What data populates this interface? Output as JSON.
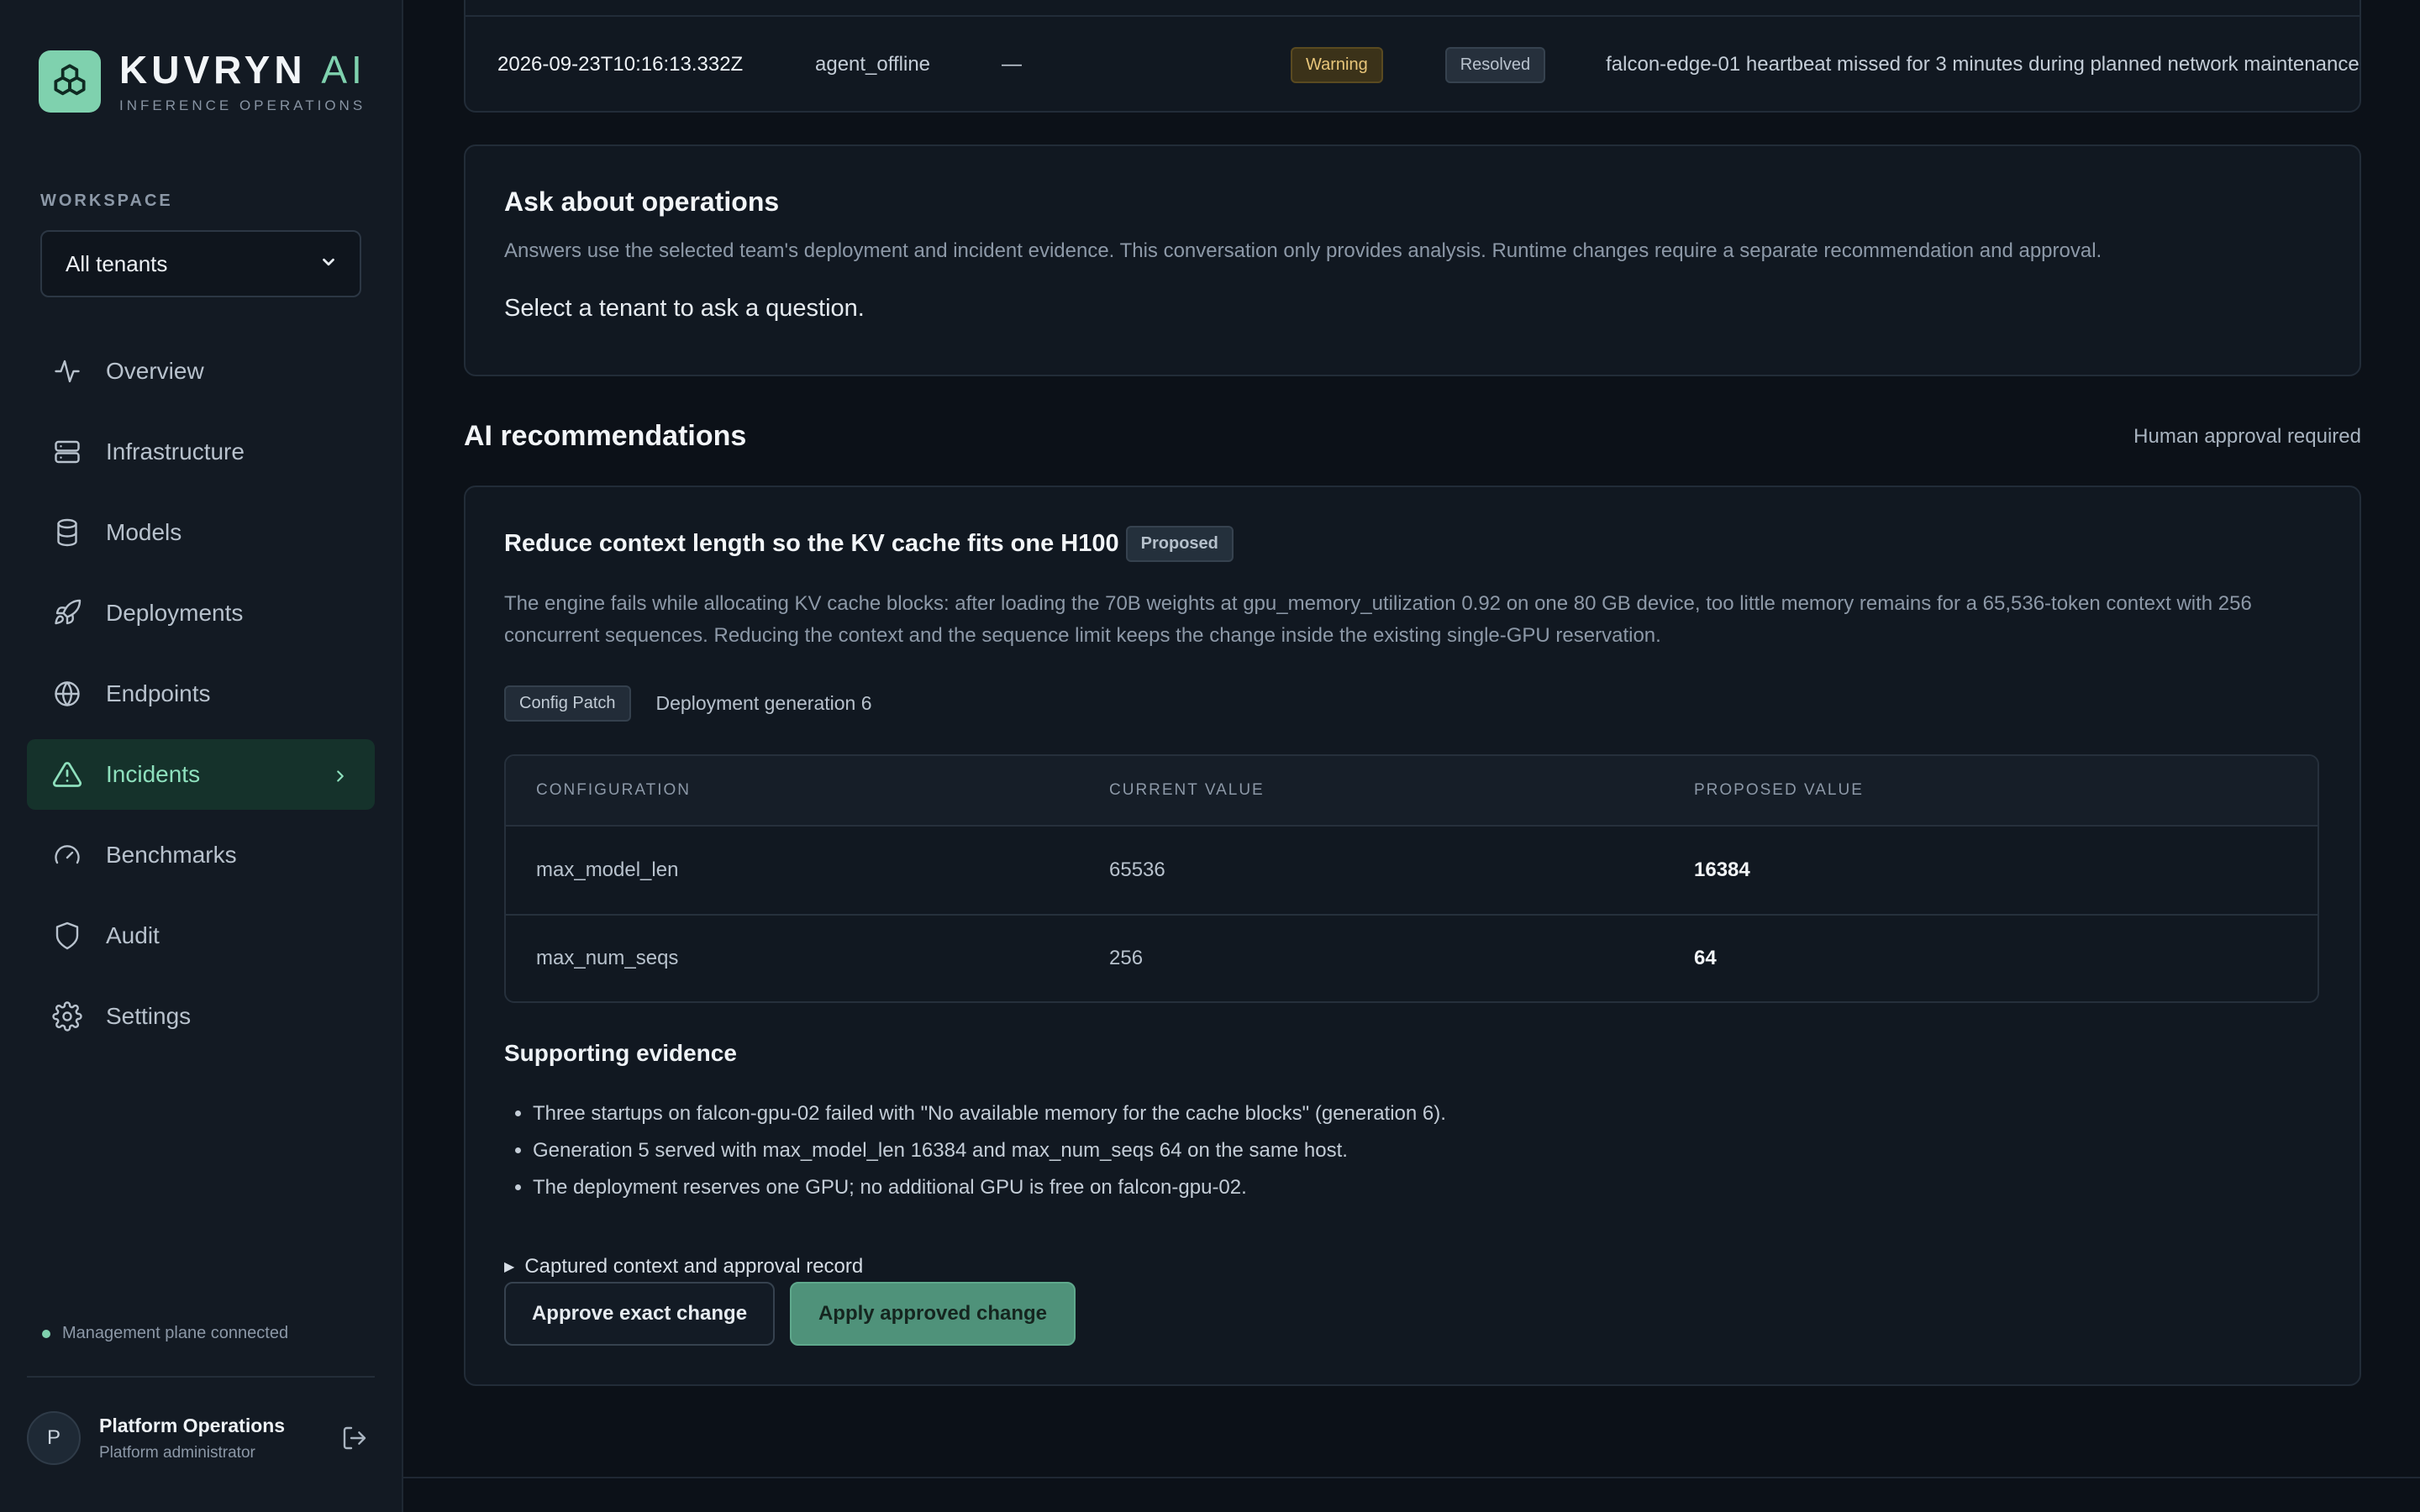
{
  "brand": {
    "name": "KUVRYN",
    "name_ai": "AI",
    "tagline": "INFERENCE OPERATIONS"
  },
  "workspace": {
    "label": "WORKSPACE",
    "selected": "All tenants"
  },
  "nav": {
    "items": [
      {
        "label": "Overview",
        "icon": "activity-icon"
      },
      {
        "label": "Infrastructure",
        "icon": "server-icon"
      },
      {
        "label": "Models",
        "icon": "database-icon"
      },
      {
        "label": "Deployments",
        "icon": "rocket-icon"
      },
      {
        "label": "Endpoints",
        "icon": "globe-icon"
      },
      {
        "label": "Incidents",
        "icon": "alert-triangle-icon",
        "active": true
      },
      {
        "label": "Benchmarks",
        "icon": "gauge-icon"
      },
      {
        "label": "Audit",
        "icon": "shield-icon"
      },
      {
        "label": "Settings",
        "icon": "gear-icon"
      }
    ]
  },
  "status": {
    "text": "Management plane connected",
    "color": "#7fd1ae"
  },
  "user": {
    "initial": "P",
    "name": "Platform Operations",
    "role": "Platform administrator"
  },
  "incident_row": {
    "timestamp": "2026-09-23T10:16:13.332Z",
    "type": "agent_offline",
    "dash": "—",
    "severity": "Warning",
    "state": "Resolved",
    "message": "falcon-edge-01 heartbeat missed for 3 minutes during planned network maintenance"
  },
  "ask": {
    "title": "Ask about operations",
    "description": "Answers use the selected team's deployment and incident evidence. This conversation only provides analysis. Runtime changes require a separate recommendation and approval.",
    "prompt": "Select a tenant to ask a question."
  },
  "recommendations": {
    "title": "AI recommendations",
    "note": "Human approval required",
    "item": {
      "title": "Reduce context length so the KV cache fits one H100",
      "badge": "Proposed",
      "body": "The engine fails while allocating KV cache blocks: after loading the 70B weights at gpu_memory_utilization 0.92 on one 80 GB device, too little memory remains for a 65,536-token context with 256 concurrent sequences. Reducing the context and the sequence limit keeps the change inside the existing single-GPU reservation.",
      "tag": "Config Patch",
      "generation": "Deployment generation 6",
      "table": {
        "headers": [
          "CONFIGURATION",
          "CURRENT VALUE",
          "PROPOSED VALUE"
        ],
        "rows": [
          [
            "max_model_len",
            "65536",
            "16384"
          ],
          [
            "max_num_seqs",
            "256",
            "64"
          ]
        ]
      },
      "evidence_title": "Supporting evidence",
      "evidence": [
        "Three startups on falcon-gpu-02 failed with \"No available memory for the cache blocks\" (generation 6).",
        "Generation 5 served with max_model_len 16384 and max_num_seqs 64 on the same host.",
        "The deployment reserves one GPU; no additional GPU is free on falcon-gpu-02."
      ],
      "details_label": "Captured context and approval record",
      "approve_label": "Approve exact change",
      "apply_label": "Apply approved change"
    }
  },
  "colors": {
    "accent": "#7fd1ae",
    "active_bg": "#15322b",
    "warning": "#e8c67a"
  }
}
